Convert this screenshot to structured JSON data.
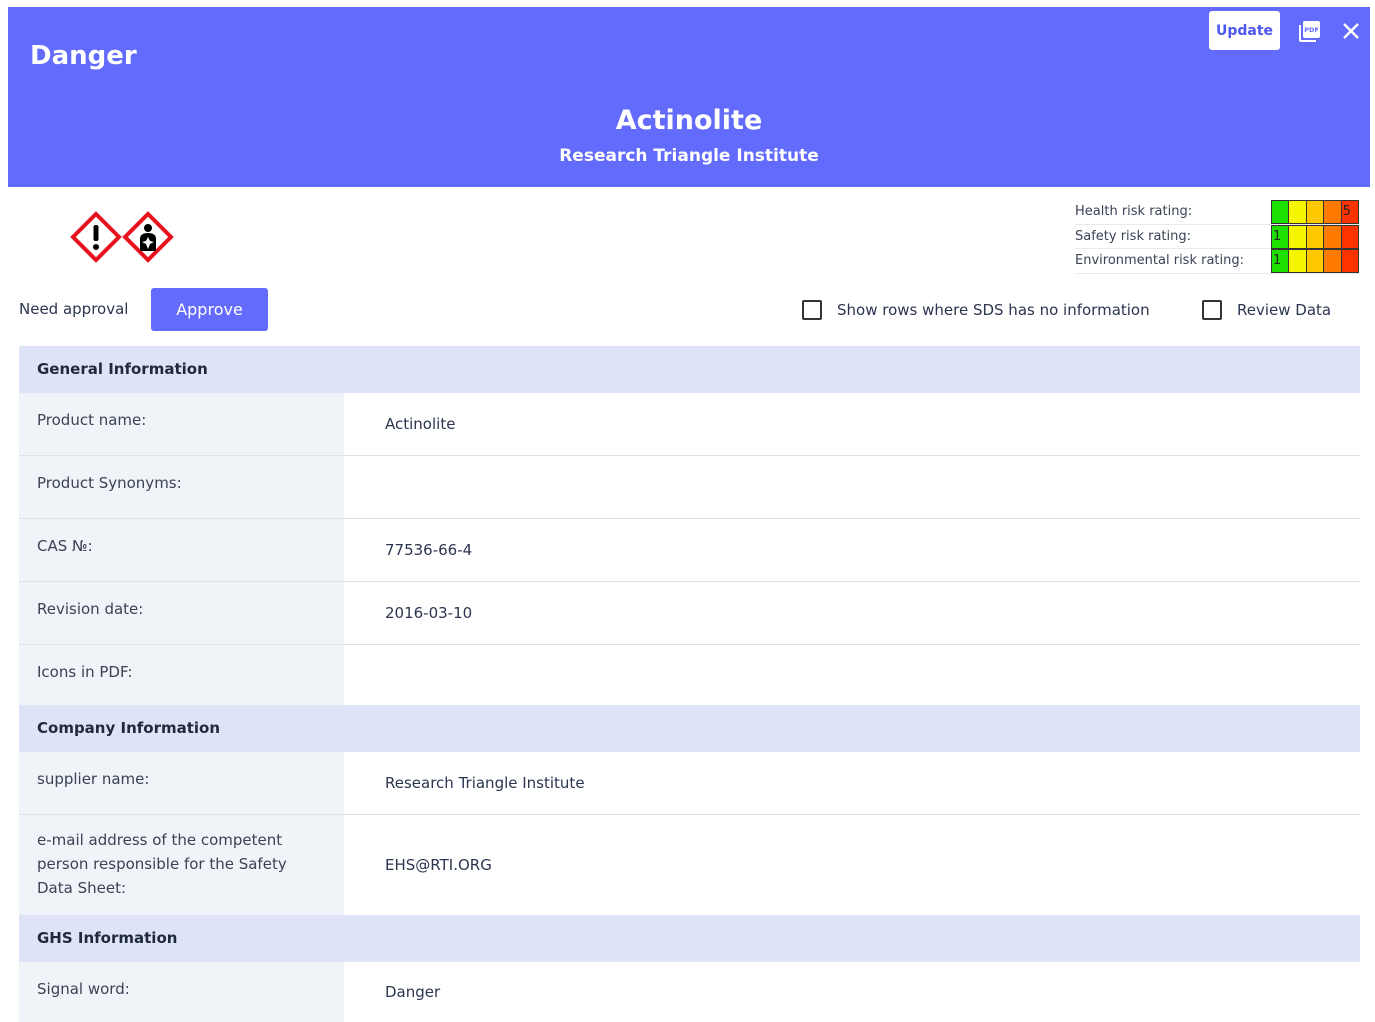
{
  "header": {
    "signal_word": "Danger",
    "product_title": "Actinolite",
    "supplier": "Research Triangle Institute",
    "update_label": "Update",
    "pdf_icon": "pdf-icon",
    "close_icon": "close-icon",
    "bg_color": "#636bfc"
  },
  "pictograms": [
    "exclamation-mark-icon",
    "health-hazard-icon"
  ],
  "risk": [
    {
      "label": "Health risk rating:",
      "value": "5",
      "level": 5
    },
    {
      "label": "Safety risk rating:",
      "value": "1",
      "level": 1
    },
    {
      "label": "Environmental risk rating:",
      "value": "1",
      "level": 1
    }
  ],
  "risk_colors": [
    "#1ee000",
    "#f5f500",
    "#ffc800",
    "#ff7a00",
    "#ff3300"
  ],
  "approval": {
    "label": "Need approval",
    "button": "Approve"
  },
  "filters": {
    "show_empty": "Show rows where SDS has no information",
    "review": "Review Data"
  },
  "sections": [
    {
      "title": "General Information",
      "rows": [
        {
          "key": "Product name:",
          "value": "Actinolite"
        },
        {
          "key": "Product Synonyms:",
          "value": ""
        },
        {
          "key": "CAS №:",
          "value": "77536-66-4"
        },
        {
          "key": "Revision date:",
          "value": "2016-03-10"
        },
        {
          "key": "Icons in PDF:",
          "value": ""
        }
      ]
    },
    {
      "title": "Company Information",
      "rows": [
        {
          "key": "supplier name:",
          "value": "Research Triangle Institute"
        },
        {
          "key": "e-mail address of the competent person responsible for the Safety Data Sheet:",
          "value": "EHS@RTI.ORG"
        }
      ]
    },
    {
      "title": "GHS Information",
      "rows": [
        {
          "key": "Signal word:",
          "value": "Danger"
        }
      ]
    }
  ]
}
